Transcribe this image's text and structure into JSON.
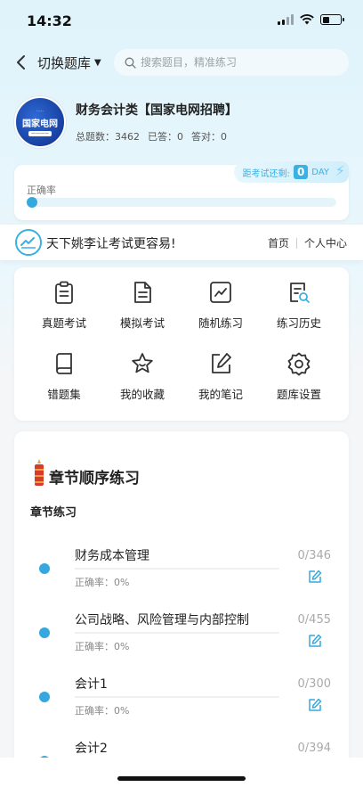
{
  "status": {
    "time": "14:32"
  },
  "nav": {
    "switch_label": "切换题库",
    "search_placeholder": "搜索题目，精准练习"
  },
  "bank": {
    "logo_text": "国家电网",
    "title": "财务会计类【国家电网招聘】",
    "total_label": "总题数：3462",
    "answered_label": "已答：0",
    "correct_label": "答对：0"
  },
  "accuracy": {
    "label": "正确率",
    "value_fraction": 0,
    "countdown_prefix": "距考试还剩:",
    "countdown_days": "0",
    "countdown_unit": "DAY"
  },
  "banner": {
    "slogan": "天下姚李让考试更容易!",
    "link_home": "首页",
    "link_profile": "个人中心"
  },
  "functions": [
    {
      "label": "真题考试",
      "icon": "clipboard-icon"
    },
    {
      "label": "模拟考试",
      "icon": "document-icon"
    },
    {
      "label": "随机练习",
      "icon": "chart-line-icon"
    },
    {
      "label": "练习历史",
      "icon": "history-search-icon"
    },
    {
      "label": "错题集",
      "icon": "book-icon"
    },
    {
      "label": "我的收藏",
      "icon": "star-icon"
    },
    {
      "label": "我的笔记",
      "icon": "note-edit-icon"
    },
    {
      "label": "题库设置",
      "icon": "settings-icon"
    }
  ],
  "chapter_section": {
    "title": "章节顺序练习",
    "subtitle": "章节练习",
    "items": [
      {
        "name": "财务成本管理",
        "accuracy": "正确率：0%",
        "count": "0/346"
      },
      {
        "name": "公司战略、风险管理与内部控制",
        "accuracy": "正确率：0%",
        "count": "0/455"
      },
      {
        "name": "会计1",
        "accuracy": "正确率：0%",
        "count": "0/300"
      },
      {
        "name": "会计2",
        "accuracy": "",
        "count": "0/394"
      }
    ]
  },
  "colors": {
    "accent": "#35a9df",
    "background": "#f4f6f8"
  }
}
